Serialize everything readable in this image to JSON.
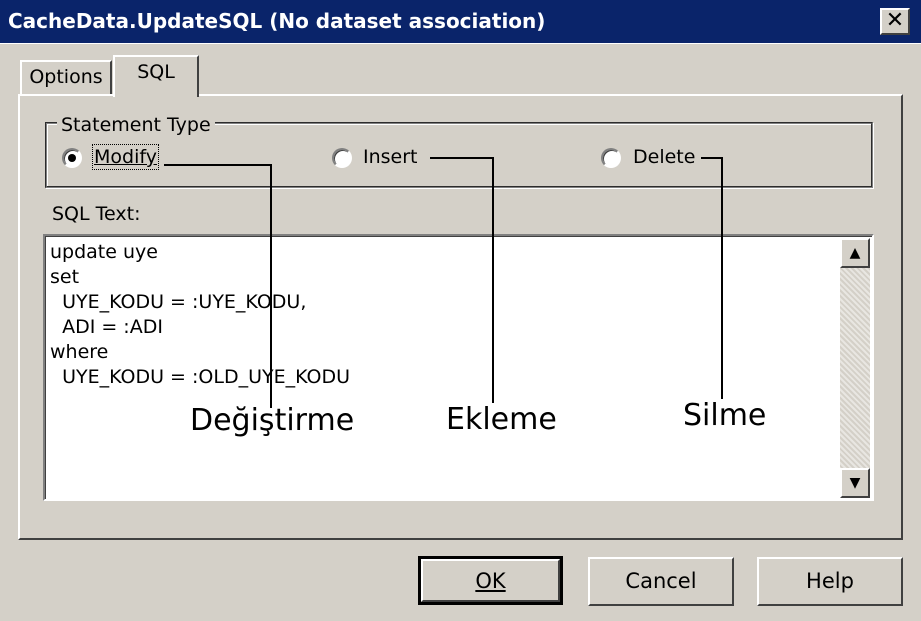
{
  "window": {
    "title": "CacheData.UpdateSQL (No dataset association)",
    "close_glyph": "✕"
  },
  "tabs": [
    {
      "label": "Options",
      "active": false
    },
    {
      "label": "SQL",
      "active": true
    }
  ],
  "statement_type": {
    "legend": "Statement Type",
    "options": [
      {
        "label": "Modify",
        "selected": true
      },
      {
        "label": "Insert",
        "selected": false
      },
      {
        "label": "Delete",
        "selected": false
      }
    ]
  },
  "sql_text": {
    "label": "SQL Text:",
    "lines": [
      "update uye",
      "set",
      "  UYE_KODU = :UYE_KODU,",
      "  ADI = :ADI",
      "where",
      "  UYE_KODU = :OLD_UYE_KODU"
    ]
  },
  "buttons": {
    "ok": "OK",
    "cancel": "Cancel",
    "help": "Help"
  },
  "annotations": {
    "modify": "Değiştirme",
    "insert": "Ekleme",
    "delete": "Silme"
  }
}
